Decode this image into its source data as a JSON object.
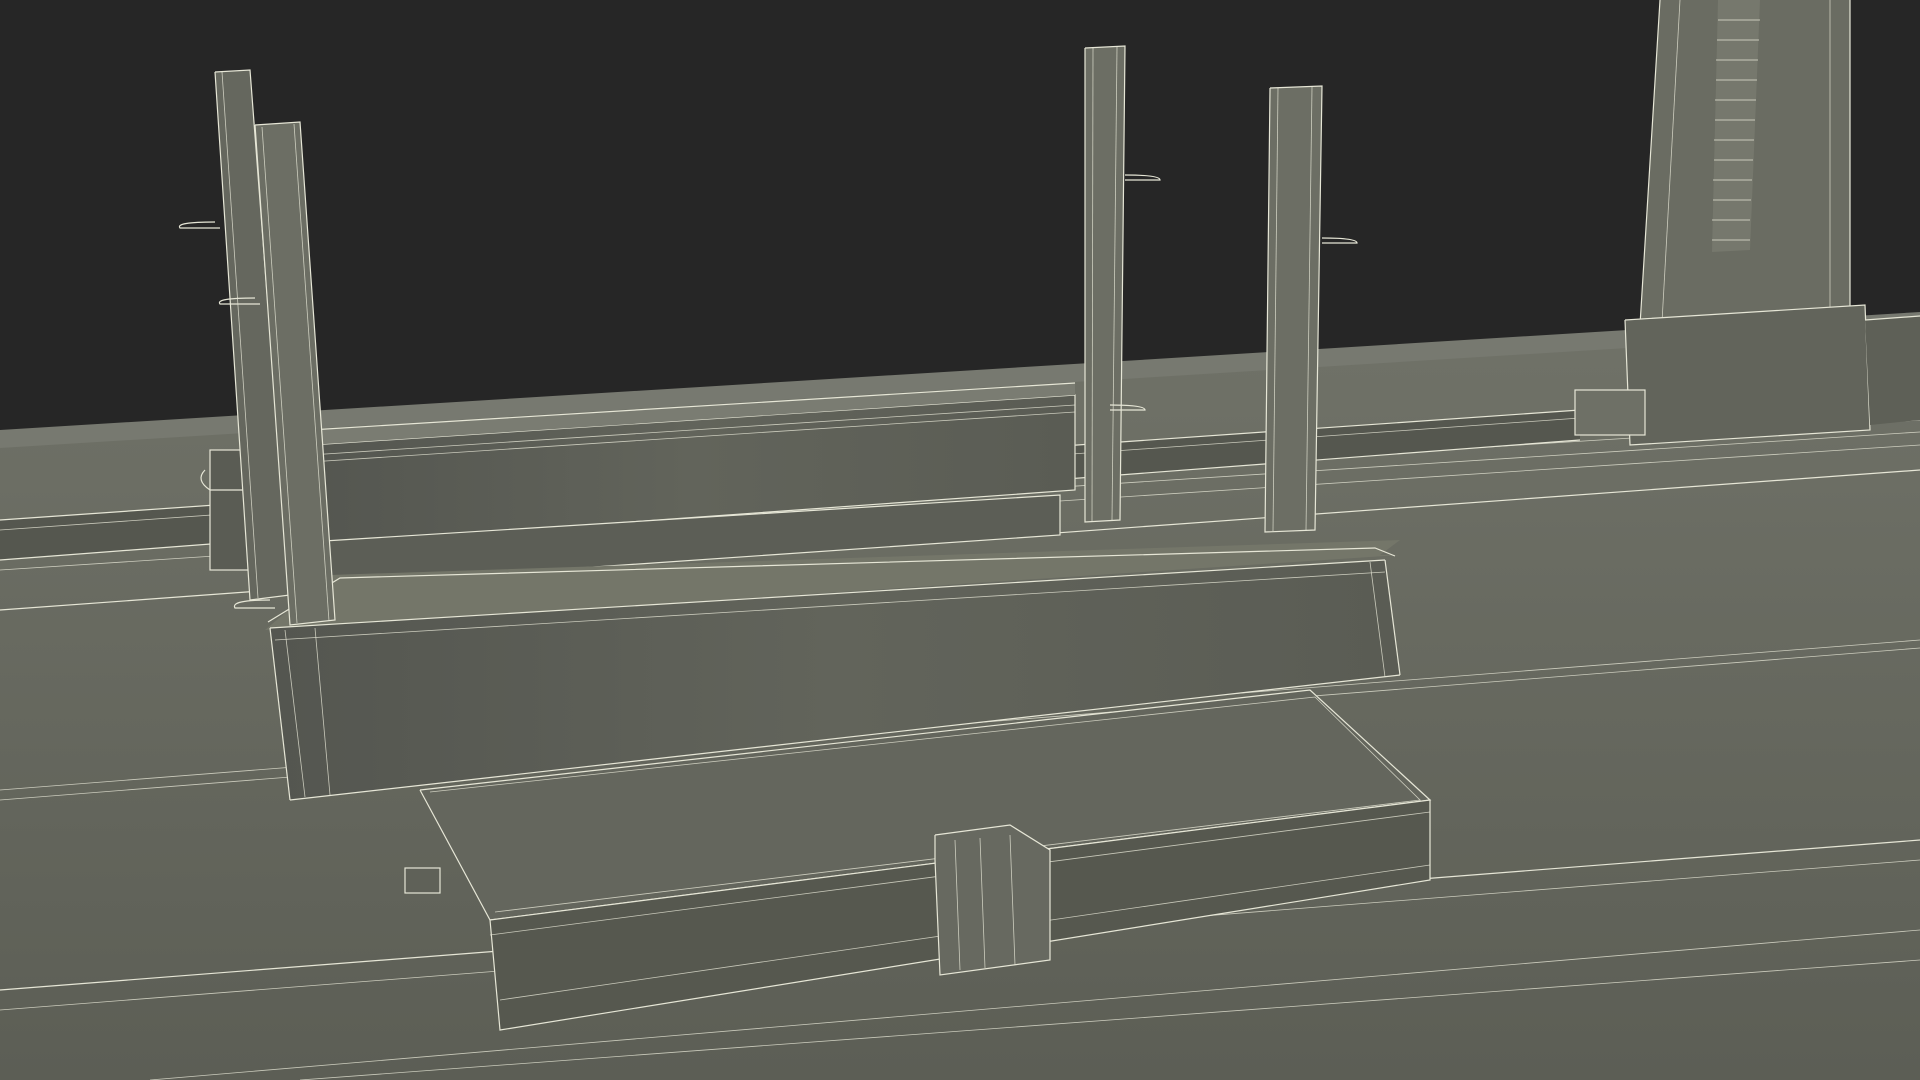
{
  "scene": {
    "description_visible": false,
    "colors": {
      "background": "#262626",
      "surface_light": "#6c6e64",
      "surface_mid": "#5f6157",
      "surface_dark": "#4f5149",
      "wire": "#e6e6d6"
    }
  }
}
